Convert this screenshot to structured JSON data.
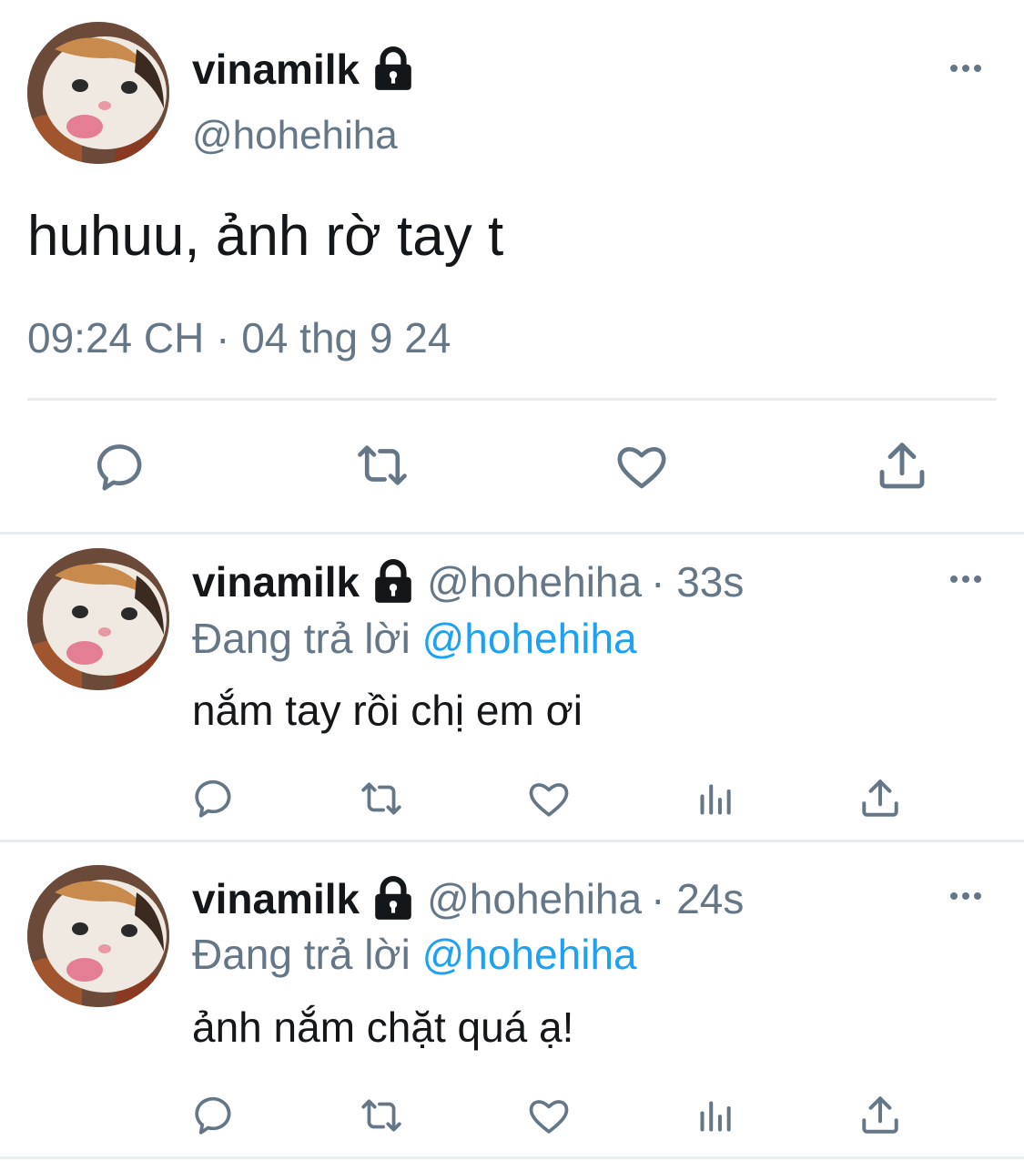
{
  "main_tweet": {
    "display_name": "vinamilk",
    "handle": "@hohehiha",
    "text": "huhuu, ảnh rờ tay t",
    "timestamp": "09:24 CH · 04 thg 9 24",
    "actions": [
      "reply-icon",
      "retweet-icon",
      "like-icon",
      "share-icon"
    ]
  },
  "replies": [
    {
      "display_name": "vinamilk",
      "handle": "@hohehiha",
      "time": "· 33s",
      "replying_prefix": "Đang trả lời",
      "replying_to": "@hohehiha",
      "text": "nắm tay rồi chị em ơi"
    },
    {
      "display_name": "vinamilk",
      "handle": "@hohehiha",
      "time": "· 24s",
      "replying_prefix": "Đang trả lời",
      "replying_to": "@hohehiha",
      "text": "ảnh nắm chặt quá ạ!"
    }
  ],
  "colors": {
    "text": "#14171a",
    "secondary": "#657786",
    "link": "#1da1f2",
    "divider": "#e6ecf0"
  }
}
